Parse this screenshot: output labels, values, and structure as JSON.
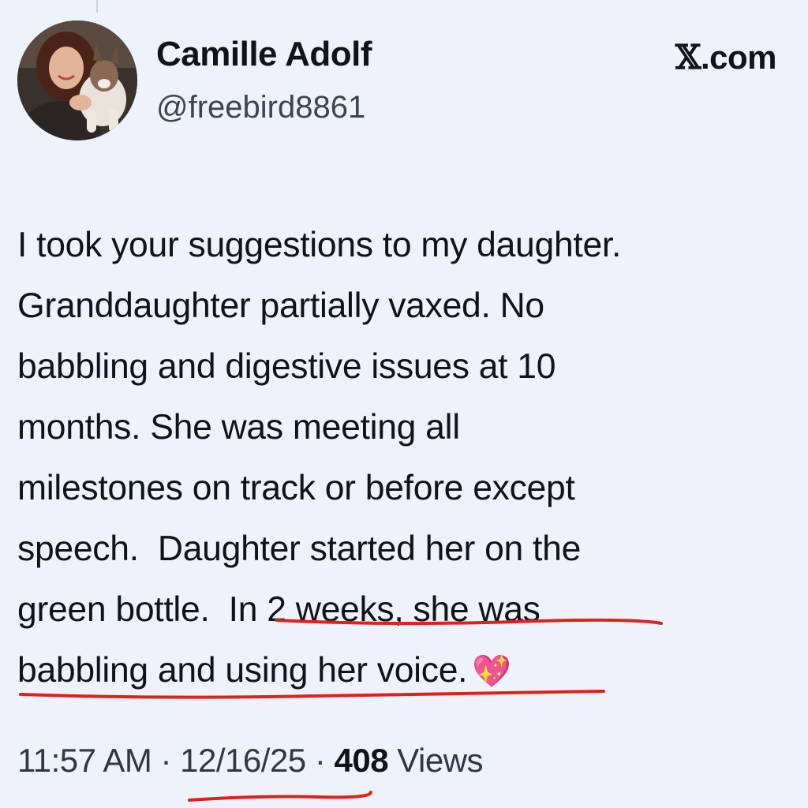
{
  "author": {
    "name": "Camille Adolf",
    "handle": "@freebird8861",
    "avatar_icon": "profile-photo-woman-with-dog"
  },
  "brand": {
    "label": ".com",
    "icon": "x-logo-icon"
  },
  "post": {
    "lines": [
      "I took your suggestions to my daughter.",
      "Granddaughter partially vaxed. No",
      "babbling and digestive issues at 10",
      "months. She was meeting all",
      "milestones on track or before except",
      "speech.  Daughter started her on the",
      "green bottle.  "
    ],
    "underlined_part1": "In 2 weeks, she was",
    "underlined_part2": "babbling and using her voice.",
    "emoji": "💖"
  },
  "meta": {
    "time": "11:57 AM",
    "separator": " · ",
    "date": "12/16/25",
    "views_count": "408",
    "views_label": " Views"
  },
  "colors": {
    "background": "#eef3fb",
    "text": "#0f1419",
    "annotation_red": "#e0201c"
  }
}
